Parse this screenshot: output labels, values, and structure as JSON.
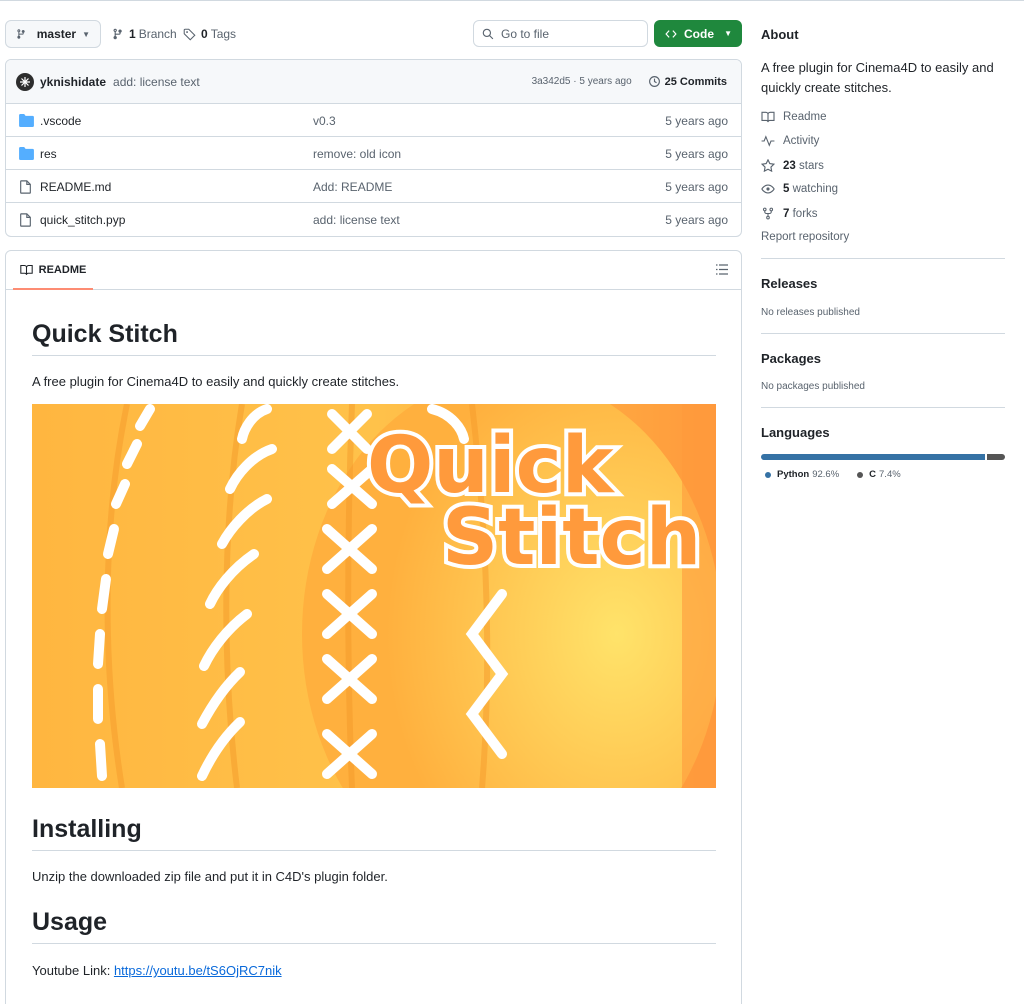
{
  "toolbar": {
    "branch_label": "master",
    "branch_count": "1",
    "branch_word": "Branch",
    "tag_count": "0",
    "tag_word": "Tags",
    "goto_placeholder": "Go to file",
    "code_label": "Code"
  },
  "commit": {
    "author": "yknishidate",
    "message": "add: license text",
    "hash_date": "3a342d5 · 5 years ago",
    "commit_count": "25 Commits"
  },
  "files": [
    {
      "name": ".vscode",
      "type": "folder",
      "message": "v0.3",
      "date": "5 years ago"
    },
    {
      "name": "res",
      "type": "folder",
      "message": "remove: old icon",
      "date": "5 years ago"
    },
    {
      "name": "README.md",
      "type": "file",
      "message": "Add: README",
      "date": "5 years ago"
    },
    {
      "name": "quick_stitch.pyp",
      "type": "file",
      "message": "add: license text",
      "date": "5 years ago"
    }
  ],
  "readme": {
    "tab_label": "README",
    "title": "Quick Stitch",
    "intro": "A free plugin for Cinema4D to easily and quickly create stitches.",
    "hero_text_line1": "Quick",
    "hero_text_line2": "Stitch",
    "installing_heading": "Installing",
    "installing_text": "Unzip the downloaded zip file and put it in C4D's plugin folder.",
    "usage_heading": "Usage",
    "usage_prefix": "Youtube Link: ",
    "usage_link": "https://youtu.be/tS6OjRC7nik"
  },
  "sidebar": {
    "about_title": "About",
    "about_desc": "A free plugin for Cinema4D to easily and quickly create stitches.",
    "links": [
      {
        "icon": "book-icon",
        "count": "",
        "label": "Readme"
      },
      {
        "icon": "pulse-icon",
        "count": "",
        "label": "Activity"
      },
      {
        "icon": "star-icon",
        "count": "23",
        "label": "stars"
      },
      {
        "icon": "eye-icon",
        "count": "5",
        "label": "watching"
      },
      {
        "icon": "fork-icon",
        "count": "7",
        "label": "forks"
      }
    ],
    "report": "Report repository",
    "releases_title": "Releases",
    "releases_text": "No releases published",
    "packages_title": "Packages",
    "packages_text": "No packages published",
    "languages_title": "Languages",
    "languages": [
      {
        "name": "Python",
        "percent": "92.6%",
        "share": 92.6,
        "color": "#3572A5"
      },
      {
        "name": "C",
        "percent": "7.4%",
        "share": 7.4,
        "color": "#555555"
      }
    ]
  },
  "colors": {
    "accent_green": "#1f883d",
    "tab_underline": "#fd8c73",
    "folder_blue": "#54aeff",
    "hero_orange": "#ff9a3c"
  }
}
